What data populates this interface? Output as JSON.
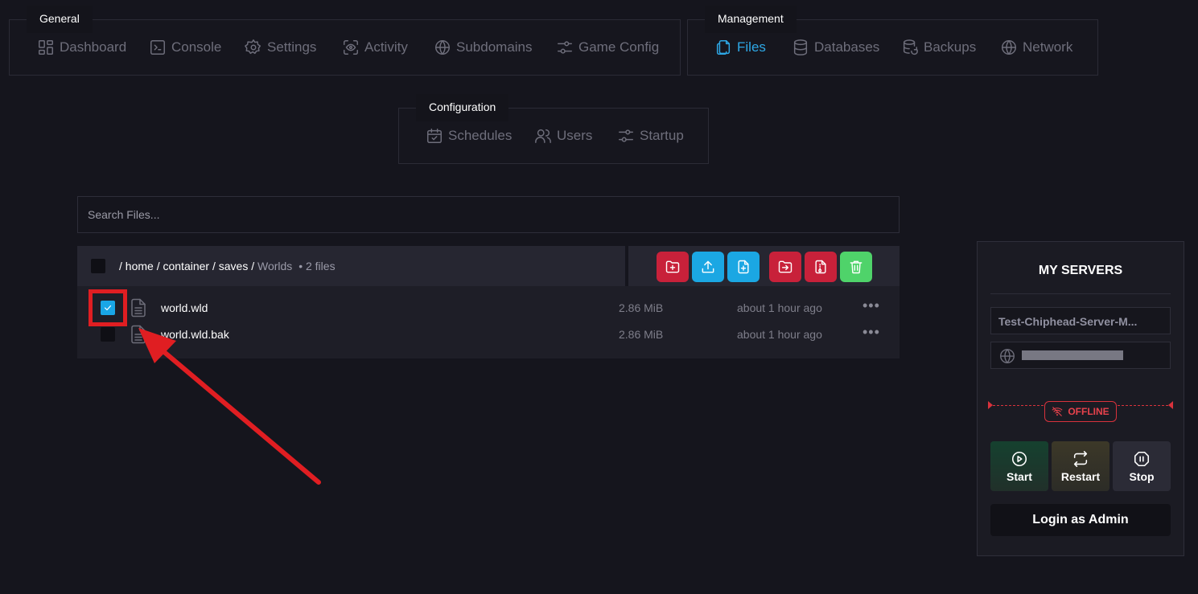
{
  "nav": {
    "general": {
      "legend": "General",
      "items": [
        "Dashboard",
        "Console",
        "Settings",
        "Activity",
        "Subdomains",
        "Game Config"
      ]
    },
    "management": {
      "legend": "Management",
      "items": [
        "Files",
        "Databases",
        "Backups",
        "Network"
      ]
    },
    "configuration": {
      "legend": "Configuration",
      "items": [
        "Schedules",
        "Users",
        "Startup"
      ]
    }
  },
  "search": {
    "placeholder": "Search Files..."
  },
  "breadcrumb": {
    "sep": "/",
    "parts": [
      "home",
      "container",
      "saves"
    ],
    "current": "Worlds",
    "count": "• 2 files"
  },
  "toolbar": {
    "icons": [
      "folder-plus-icon",
      "upload-icon",
      "file-plus-icon",
      "move-icon",
      "archive-icon",
      "trash-icon"
    ]
  },
  "files": [
    {
      "name": "world.wld",
      "size": "2.86 MiB",
      "modified": "about 1 hour ago",
      "checked": true,
      "more": "•••"
    },
    {
      "name": "world.wld.bak",
      "size": "2.86 MiB",
      "modified": "about 1 hour ago",
      "checked": false,
      "more": "•••"
    }
  ],
  "servers": {
    "title": "MY SERVERS",
    "server_name": "Test-Chiphead-Server-M...",
    "status": "OFFLINE",
    "buttons": {
      "start": "Start",
      "restart": "Restart",
      "stop": "Stop"
    },
    "admin_label": "Login as Admin"
  },
  "colors": {
    "accent": "#2ea8e6",
    "danger": "#c8213a",
    "success": "#4fd36a",
    "annotation": "#e01e22"
  }
}
